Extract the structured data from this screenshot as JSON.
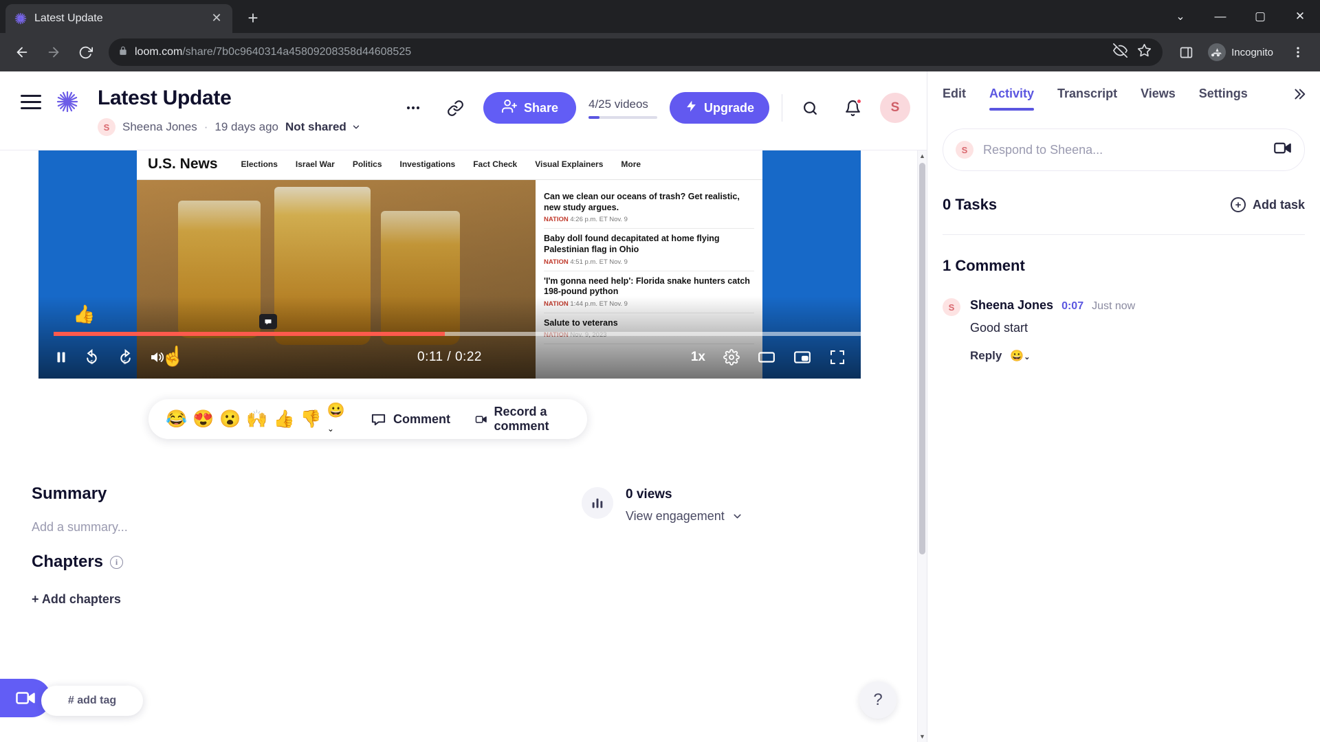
{
  "browser": {
    "tab": {
      "title": "Latest Update",
      "favicon_icon": "loom-logo-icon",
      "close_icon": "close-icon"
    },
    "new_tab_icon": "plus-icon",
    "window": {
      "minimize": "—",
      "maximize": "▢",
      "close": "✕",
      "chevron": "⌄"
    },
    "nav": {
      "back_icon": "back-arrow-icon",
      "forward_icon": "forward-arrow-icon",
      "reload_icon": "reload-icon"
    },
    "address": {
      "lock_icon": "lock-icon",
      "domain": "loom.com",
      "path": "/share/7b0c9640314a45809208358d44608525",
      "full_url": "loom.com/share/7b0c9640314a45809208358d44608525"
    },
    "omnibox_actions": {
      "tracking_icon": "eye-off-icon",
      "bookmark_icon": "star-icon",
      "sidepanel_icon": "side-panel-icon",
      "menu_icon": "kebab-icon"
    },
    "incognito": {
      "label": "Incognito",
      "avatar_icon": "incognito-hat-icon"
    }
  },
  "header": {
    "menu_icon": "hamburger-icon",
    "logo_icon": "loom-logo-icon",
    "title": "Latest Update",
    "author": {
      "initial": "S",
      "name": "Sheena Jones"
    },
    "separator": "·",
    "date": "19 days ago",
    "sharing": {
      "label": "Not shared",
      "chevron": "chevron-down-icon"
    },
    "more_icon": "ellipsis-icon",
    "link_icon": "link-icon",
    "share": {
      "label": "Share",
      "icon": "people-add-icon"
    },
    "videos": {
      "label": "4/25 videos",
      "progress_pct": 16
    },
    "upgrade": {
      "label": "Upgrade",
      "icon": "lightning-bolt-icon"
    },
    "search_icon": "search-icon",
    "notifications_icon": "bell-icon",
    "user_avatar": "S"
  },
  "video": {
    "current_time": "0:11",
    "separator": "/",
    "duration": "0:22",
    "progress_pct": 48.5,
    "speed": "1x",
    "controls": {
      "pause_icon": "pause-icon",
      "rewind_icon": "rewind-5-icon",
      "forward_icon": "forward-5-icon",
      "volume_icon": "volume-icon",
      "settings_icon": "gear-icon",
      "theater_icon": "theater-mode-icon",
      "pip_icon": "picture-in-picture-icon",
      "fullscreen_icon": "fullscreen-icon"
    },
    "thumb_reaction": "👍",
    "comment_marker_icon": "comment-marker-icon",
    "content": {
      "site_brand": "U.S. News",
      "nav": [
        "Elections",
        "Israel War",
        "Politics",
        "Investigations",
        "Fact Check",
        "Visual Explainers",
        "More"
      ],
      "headlines": [
        {
          "title": "Can we clean our oceans of trash? Get realistic, new study argues.",
          "section": "NATION",
          "meta": "4:26 p.m. ET Nov. 9"
        },
        {
          "title": "Baby doll found decapitated at home flying Palestinian flag in Ohio",
          "section": "NATION",
          "meta": "4:51 p.m. ET Nov. 9"
        },
        {
          "title": "'I'm gonna need help': Florida snake hunters catch 198-pound python",
          "section": "NATION",
          "meta": "1:44 p.m. ET Nov. 9"
        },
        {
          "title": "Salute to veterans",
          "section": "NATION",
          "meta": "Nov. 9, 2023"
        }
      ]
    }
  },
  "reactions": {
    "emojis": [
      "😂",
      "😍",
      "😮",
      "🙌",
      "👍",
      "👎"
    ],
    "more_icon": "emoji-picker-icon",
    "comment": {
      "label": "Comment",
      "icon": "comment-icon"
    },
    "record": {
      "label": "Record a comment",
      "icon": "video-camera-icon"
    }
  },
  "summary": {
    "heading": "Summary",
    "placeholder": "Add a summary...",
    "chapters_heading": "Chapters",
    "chapters_info_icon": "info-icon",
    "add_chapters": "+ Add chapters"
  },
  "engagement": {
    "icon": "bar-chart-icon",
    "views": "0 views",
    "link": "View engagement",
    "chevron": "chevron-down-icon"
  },
  "floating": {
    "record_icon": "video-camera-icon",
    "tag_label": "# add tag",
    "help_label": "?"
  },
  "panel": {
    "tabs": [
      {
        "label": "Edit",
        "active": false
      },
      {
        "label": "Activity",
        "active": true
      },
      {
        "label": "Transcript",
        "active": false
      },
      {
        "label": "Views",
        "active": false
      },
      {
        "label": "Settings",
        "active": false
      }
    ],
    "collapse_icon": "chevrons-right-icon",
    "respond": {
      "avatar": "S",
      "placeholder": "Respond to Sheena...",
      "record_icon": "video-camera-icon"
    },
    "tasks": {
      "count_label": "0 Tasks",
      "add_label": "Add task",
      "add_icon": "plus-circle-icon"
    },
    "comments": {
      "count_label": "1 Comment",
      "items": [
        {
          "avatar": "S",
          "author": "Sheena Jones",
          "timestamp": "0:07",
          "when": "Just now",
          "text": "Good start",
          "reply_label": "Reply",
          "reaction_icon": "emoji-picker-icon"
        }
      ]
    }
  },
  "colors": {
    "brand_purple": "#625df5",
    "accent_purple": "#5b56e0",
    "progress_red": "#fd5a4d",
    "notification_red": "#f5455c"
  }
}
